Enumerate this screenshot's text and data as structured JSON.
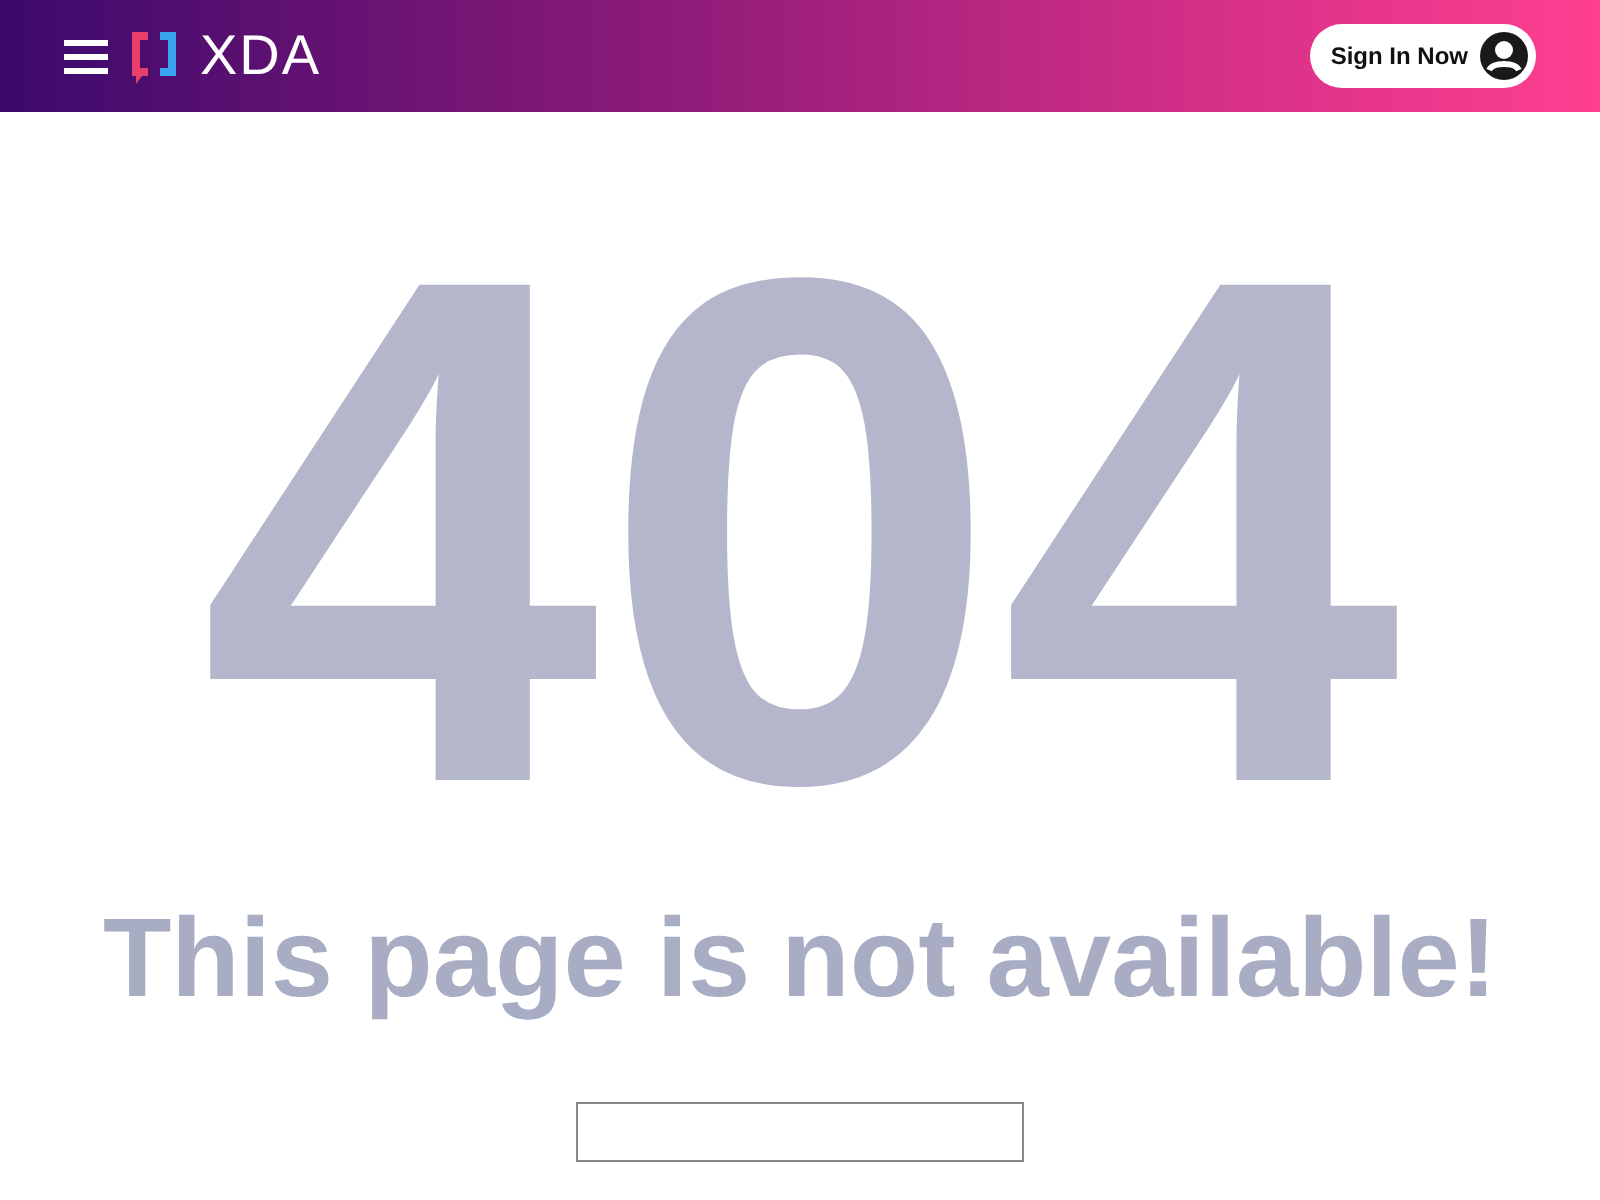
{
  "header": {
    "logo_text": "XDA",
    "sign_in": "Sign In Now"
  },
  "error": {
    "code": "404",
    "message": "This page is not available!"
  }
}
